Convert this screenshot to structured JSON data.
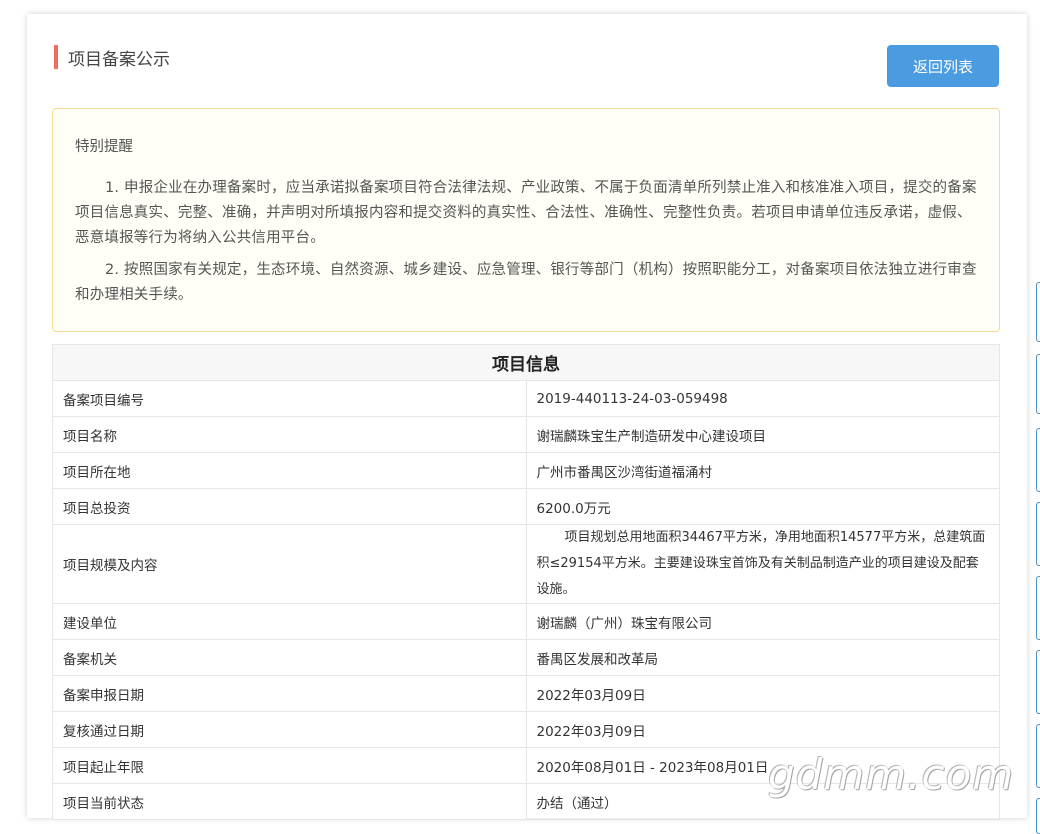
{
  "header": {
    "title": "项目备案公示",
    "back_button": "返回列表"
  },
  "notice": {
    "title": "特别提醒",
    "items": [
      "1. 申报企业在办理备案时，应当承诺拟备案项目符合法律法规、产业政策、不属于负面清单所列禁止准入和核准准入项目，提交的备案项目信息真实、完整、准确，并声明对所填报内容和提交资料的真实性、合法性、准确性、完整性负责。若项目申请单位违反承诺，虚假、恶意填报等行为将纳入公共信用平台。",
      "2. 按照国家有关规定，生态环境、自然资源、城乡建设、应急管理、银行等部门（机构）按照职能分工，对备案项目依法独立进行审查和办理相关手续。"
    ]
  },
  "info": {
    "title": "项目信息",
    "rows": [
      {
        "label": "备案项目编号",
        "value": "2019-440113-24-03-059498"
      },
      {
        "label": "项目名称",
        "value": "谢瑞麟珠宝生产制造研发中心建设项目"
      },
      {
        "label": "项目所在地",
        "value": "广州市番禺区沙湾街道福涌村"
      },
      {
        "label": "项目总投资",
        "value": "6200.0万元"
      },
      {
        "label": "项目规模及内容",
        "value": "项目规划总用地面积34467平方米，净用地面积14577平方米，总建筑面积≤29154平方米。主要建设珠宝首饰及有关制品制造产业的项目建设及配套设施。"
      },
      {
        "label": "建设单位",
        "value": "谢瑞麟（广州）珠宝有限公司"
      },
      {
        "label": "备案机关",
        "value": "番禺区发展和改革局"
      },
      {
        "label": "备案申报日期",
        "value": "2022年03月09日"
      },
      {
        "label": "复核通过日期",
        "value": "2022年03月09日"
      },
      {
        "label": "项目起止年限",
        "value": "2020年08月01日 - 2023年08月01日"
      },
      {
        "label": "项目当前状态",
        "value": "办结（通过）"
      }
    ]
  },
  "watermark": "gdmm.com",
  "colors": {
    "accent_bar": "#ef6d5a",
    "button": "#4a9be0",
    "notice_border": "#f2dc8c"
  }
}
